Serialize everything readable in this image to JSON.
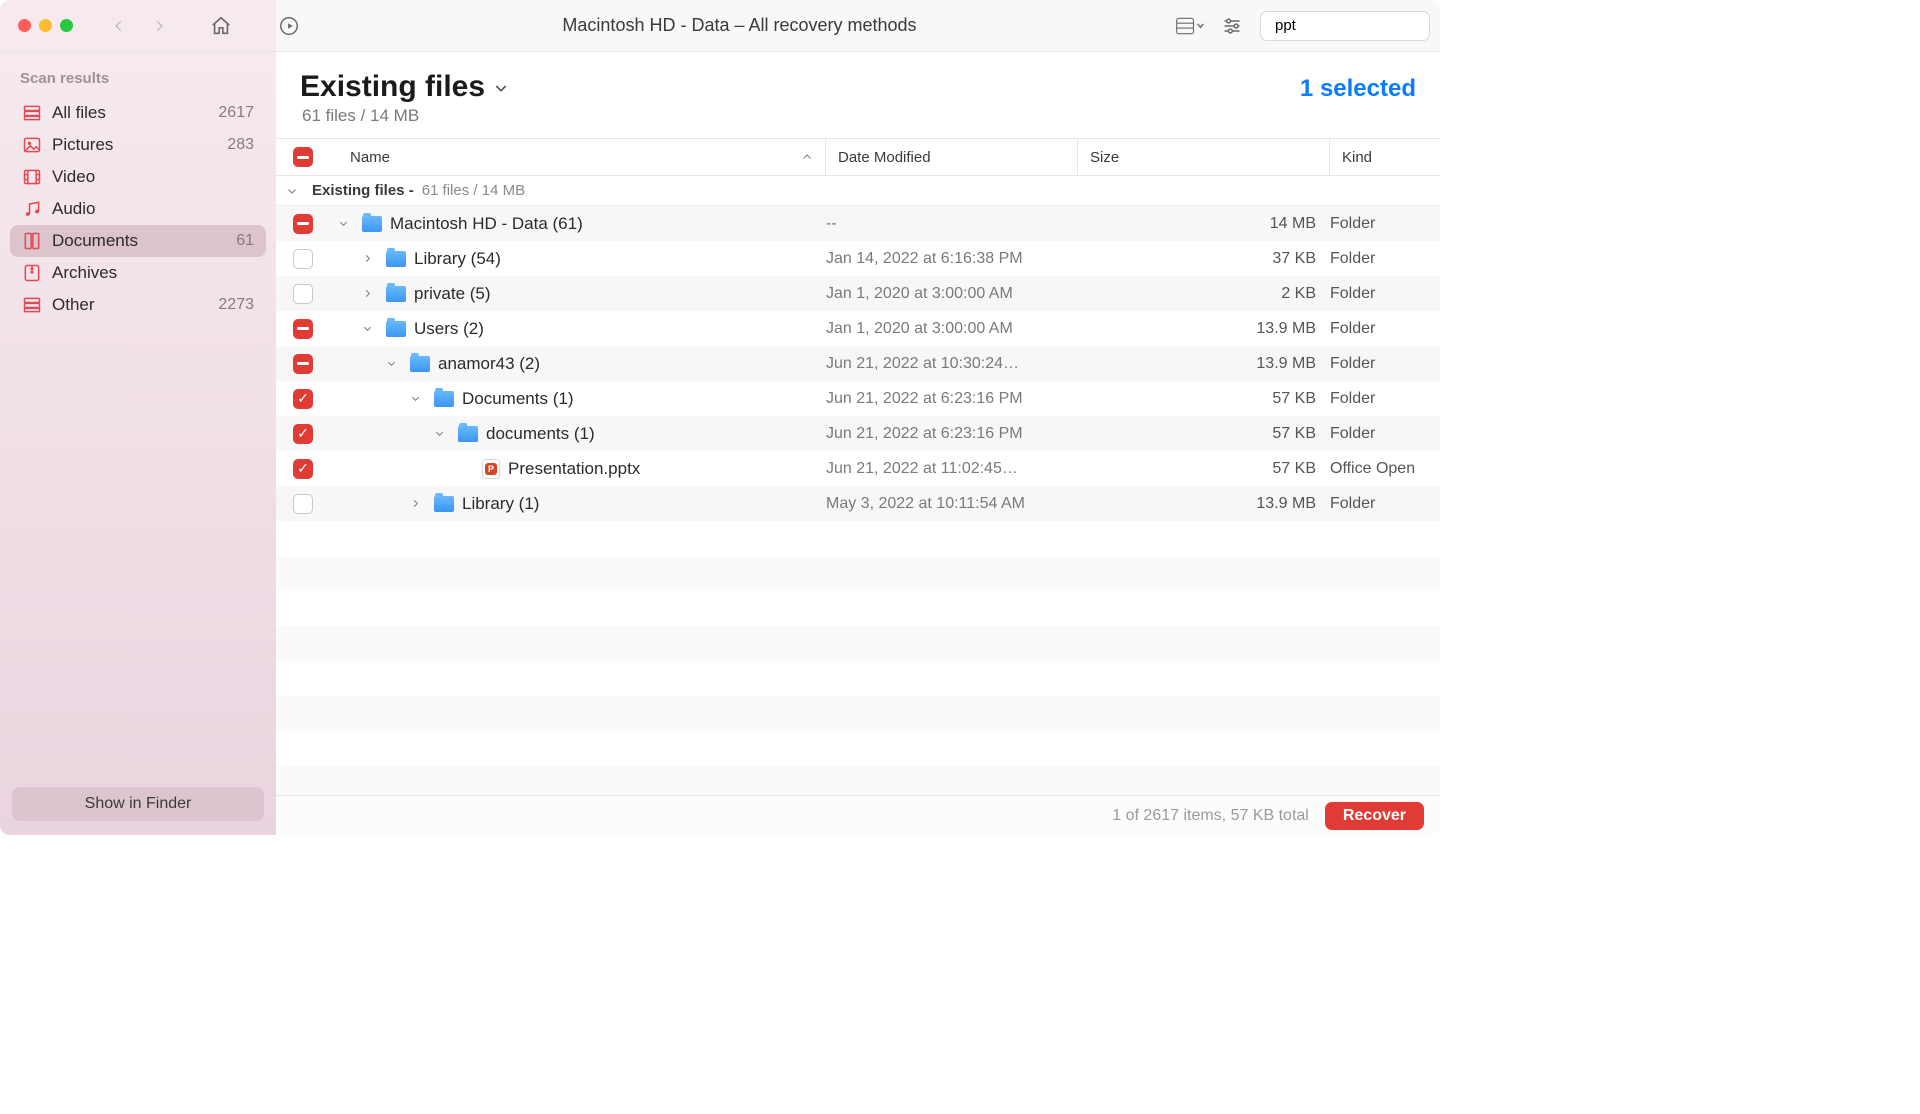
{
  "toolbar": {
    "window_title": "Macintosh HD - Data – All recovery methods",
    "search_value": "ppt"
  },
  "sidebar": {
    "header": "Scan results",
    "items": [
      {
        "icon": "stack",
        "label": "All files",
        "count": "2617"
      },
      {
        "icon": "image",
        "label": "Pictures",
        "count": "283"
      },
      {
        "icon": "film",
        "label": "Video",
        "count": ""
      },
      {
        "icon": "music",
        "label": "Audio",
        "count": ""
      },
      {
        "icon": "doc",
        "label": "Documents",
        "count": "61",
        "active": true
      },
      {
        "icon": "archive",
        "label": "Archives",
        "count": ""
      },
      {
        "icon": "stack",
        "label": "Other",
        "count": "2273"
      }
    ],
    "show_in_finder": "Show in Finder"
  },
  "main": {
    "title": "Existing files",
    "subtitle": "61 files / 14 MB",
    "selected_label": "1 selected",
    "columns": {
      "name": "Name",
      "date": "Date Modified",
      "size": "Size",
      "kind": "Kind"
    },
    "group": {
      "name": "Existing files - ",
      "meta": "61 files / 14 MB"
    },
    "rows": [
      {
        "check": "minus",
        "indent": 0,
        "chev": "down",
        "icon": "folder",
        "name": "Macintosh HD - Data (61)",
        "date": "--",
        "size": "14 MB",
        "kind": "Folder"
      },
      {
        "check": "empty",
        "indent": 1,
        "chev": "right",
        "icon": "folder",
        "name": "Library (54)",
        "date": "Jan 14, 2022 at 6:16:38 PM",
        "size": "37 KB",
        "kind": "Folder"
      },
      {
        "check": "empty",
        "indent": 1,
        "chev": "right",
        "icon": "folder",
        "name": "private (5)",
        "date": "Jan 1, 2020 at 3:00:00 AM",
        "size": "2 KB",
        "kind": "Folder"
      },
      {
        "check": "minus",
        "indent": 1,
        "chev": "down",
        "icon": "folder",
        "name": "Users (2)",
        "date": "Jan 1, 2020 at 3:00:00 AM",
        "size": "13.9 MB",
        "kind": "Folder"
      },
      {
        "check": "minus",
        "indent": 2,
        "chev": "down",
        "icon": "folder",
        "name": "anamor43 (2)",
        "date": "Jun 21, 2022 at 10:30:24…",
        "size": "13.9 MB",
        "kind": "Folder"
      },
      {
        "check": "check",
        "indent": 3,
        "chev": "down",
        "icon": "folder",
        "name": "Documents (1)",
        "date": "Jun 21, 2022 at 6:23:16 PM",
        "size": "57 KB",
        "kind": "Folder"
      },
      {
        "check": "check",
        "indent": 4,
        "chev": "down",
        "icon": "folder",
        "name": "documents (1)",
        "date": "Jun 21, 2022 at 6:23:16 PM",
        "size": "57 KB",
        "kind": "Folder"
      },
      {
        "check": "check",
        "indent": 5,
        "chev": "",
        "icon": "ppt",
        "name": "Presentation.pptx",
        "date": "Jun 21, 2022 at 11:02:45…",
        "size": "57 KB",
        "kind": "Office Open"
      },
      {
        "check": "empty",
        "indent": 3,
        "chev": "right",
        "icon": "folder",
        "name": "Library (1)",
        "date": "May 3, 2022 at 10:11:54 AM",
        "size": "13.9 MB",
        "kind": "Folder"
      }
    ]
  },
  "footer": {
    "status": "1 of 2617 items, 57 KB total",
    "recover": "Recover"
  }
}
